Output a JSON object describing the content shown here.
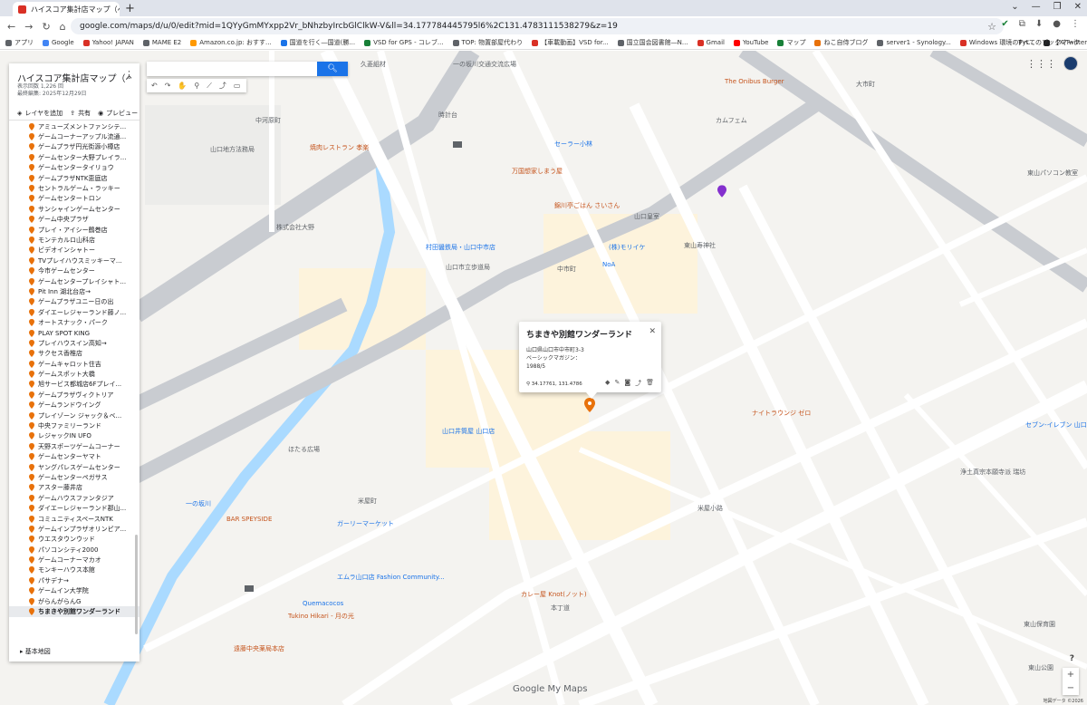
{
  "browser": {
    "tab_title": "ハイスコア集計店マップ（ベーシック...",
    "url": "google.com/maps/d/u/0/edit?mid=1QYyGmMYxpp2Vr_bNhzbyIrcbGlClkW-V&ll=34.177784445795l6%2C131.4783111538279&z=19",
    "bookmarks": [
      "アプリ",
      "Google",
      "Yahoo! JAPAN",
      "MAME E2",
      "Amazon.co.jp: おすす...",
      "国道を行く―国道(勝...",
      "VSD for GPS - コレブ...",
      "TOP: 物置部屋代わり",
      "【車載動画】VSD for...",
      "国立国会図書館―N...",
      "Gmail",
      "YouTube",
      "マップ",
      "ねこ自侍ブログ",
      "server1 - Synology...",
      "Windows 環境のPyt...",
      "【X(Twitter) bot】GAS...",
      "【自動投稿】GASスプ..."
    ],
    "bookmarks_right": "すべてのブックマーク"
  },
  "panel": {
    "title": "ハイスコア集計店マップ（ベーシ...",
    "views": "表示回数 1,226 回",
    "updated": "最終編集: 2025年12月29日",
    "add_layer": "レイヤを追加",
    "share": "共有",
    "preview": "プレビュー",
    "base_map": "基本地図",
    "items": [
      "アミューズメントファンシテ...",
      "ゲームコーナーアップル流通...",
      "ゲームプラザ円光街源小樽店",
      "ゲームセンター大野プレイラ...",
      "ゲームセンタータイリョウ",
      "ゲームプラザNTK恵庭店",
      "セントラルゲーム・ラッキー",
      "ゲームセンタートロン",
      "サンシャインゲームセンター",
      "ゲーム中央プラザ",
      "プレイ・アイシー鶴巻店",
      "モンテカルロ山科店",
      "ビデオインシャトー",
      "TVプレイハウスミッキーマ...",
      "今市ゲームセンター",
      "ゲームセンタープレイシャト...",
      "Pit Inn 湖北台店→",
      "ゲームプラザユニー日の出",
      "ダイエーレジャーランド藤ノ...",
      "オートスナック・パーク",
      "PLAY SPOT KING",
      "プレイハウスイン高知→",
      "サクセス香椎店",
      "ゲームキャロット住吉",
      "ゲームスポット大橋",
      "旭サービス都城店6Fプレイ...",
      "ゲームプラザヴィクトリア",
      "ゲームランドウイング",
      "プレイゾーン ジャック＆ベ...",
      "中央ファミリーランド",
      "レジャックIN UFO",
      "天野スポーツゲームコーナー",
      "ゲームセンターヤマト",
      "ヤングパレスゲームセンター",
      "ゲームセンターペガサス",
      "アスター藤井店",
      "ゲームハウスファンタジア",
      "ダイエーレジャーランド郡山...",
      "コミュニティスペースNTK",
      "ゲームインプラザオリンピア...",
      "ウエスタウンウッド",
      "パソコンシティ2000",
      "ゲームコーナーマカオ",
      "モンキーハウス本館",
      "パサデナ→",
      "ゲームイン大学院",
      "がらんがらんG",
      "ちまきや別館ワンダーランド"
    ]
  },
  "popup": {
    "title": "ちまきや別館ワンダーランド",
    "address": "山口県山口市中市町3-3",
    "magazine": "ベーシックマガジン：",
    "date": "1988/5",
    "coords": "34.17761, 131.4786"
  },
  "map": {
    "labels": [
      {
        "t": "久菱組材",
        "c": "g"
      },
      {
        "t": "一の坂川交通交流広場",
        "c": "g"
      },
      {
        "t": "中河原町",
        "c": "g"
      },
      {
        "t": "山口地方法務局",
        "c": "g"
      },
      {
        "t": "焼肉レストラン 孝楽",
        "c": "o"
      },
      {
        "t": "時計台",
        "c": "g"
      },
      {
        "t": "セーラー小林",
        "c": "b"
      },
      {
        "t": "万国想家しまう屋",
        "c": "o"
      },
      {
        "t": "錦川亭ごはん さいさん",
        "c": "o"
      },
      {
        "t": "山口皇室",
        "c": "g"
      },
      {
        "t": "中市町",
        "c": "g"
      },
      {
        "t": "(株)モリイケ",
        "c": "b"
      },
      {
        "t": "東山寿神社",
        "c": "g"
      },
      {
        "t": "株式会社大野",
        "c": "g"
      },
      {
        "t": "村田醤鉄局・山口中市店",
        "c": "b"
      },
      {
        "t": "山口市立歩道局",
        "c": "g"
      },
      {
        "t": "NoA",
        "c": "b"
      },
      {
        "t": "大市町",
        "c": "g"
      },
      {
        "t": "The Onibus Burger",
        "c": "o"
      },
      {
        "t": "カムフェム",
        "c": "g"
      },
      {
        "t": "東山パソコン教室",
        "c": "g"
      },
      {
        "t": "米屋町",
        "c": "g"
      },
      {
        "t": "ガーリーマーケット",
        "c": "b"
      },
      {
        "t": "エムラ山口店 Fashion Community...",
        "c": "b"
      },
      {
        "t": "Quemacocos",
        "c": "b"
      },
      {
        "t": "Tukino Hikari - 月の光",
        "c": "o"
      },
      {
        "t": "BAR SPEYSIDE",
        "c": "o"
      },
      {
        "t": "ほたる広場",
        "c": "g"
      },
      {
        "t": "山口井筒屋 山口店",
        "c": "b"
      },
      {
        "t": "ナイトラウンジ ゼロ",
        "c": "o"
      },
      {
        "t": "セブン-イレブン 山口米屋町店",
        "c": "b"
      },
      {
        "t": "浄土真宗本願寺派 瑞坊",
        "c": "g"
      },
      {
        "t": "遠藤中央薬局本店",
        "c": "o"
      },
      {
        "t": "カレー屋 Knot(ノット)",
        "c": "o"
      },
      {
        "t": "東山保育園",
        "c": "g"
      },
      {
        "t": "東山公園",
        "c": "g"
      },
      {
        "t": "米屋小路",
        "c": "g"
      },
      {
        "t": "本丁道",
        "c": "g"
      },
      {
        "t": "一の坂川",
        "c": "b"
      }
    ]
  },
  "footer": {
    "logo": "Google My Maps",
    "copyright": "地図データ ©2026",
    "help": "?",
    "zoom_in": "+",
    "zoom_out": "−"
  }
}
